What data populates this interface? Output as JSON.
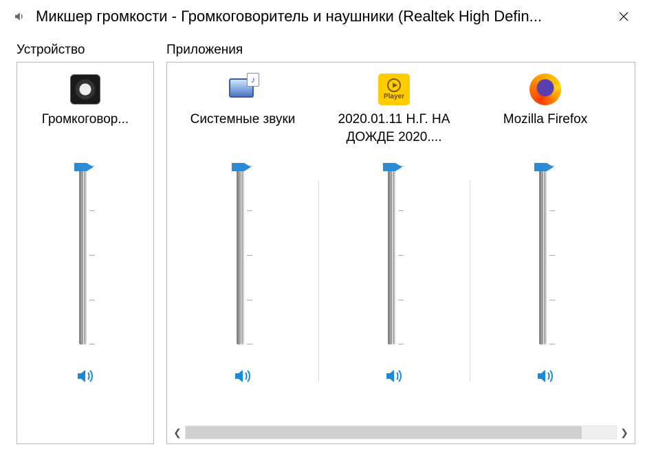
{
  "window": {
    "title": "Микшер громкости - Громкоговоритель и наушники (Realtek High Defin..."
  },
  "sections": {
    "device_title": "Устройство",
    "apps_title": "Приложения"
  },
  "device": {
    "label": "Громкоговор..."
  },
  "apps": [
    {
      "label": "Системные звуки"
    },
    {
      "label": "2020.01.11 Н.Г. НА ДОЖДЕ 2020...."
    },
    {
      "label": "Mozilla Firefox"
    }
  ],
  "player_icon_text": "Player"
}
